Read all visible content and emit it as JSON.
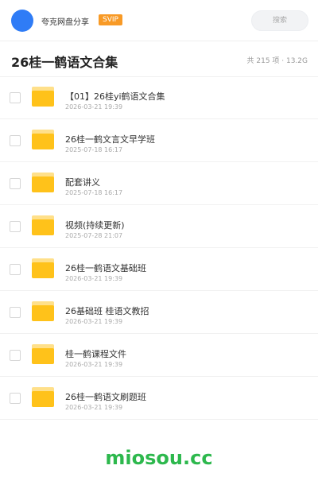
{
  "topbar": {
    "username": "夸克网盘分享",
    "vip_badge": "SVIP",
    "search_placeholder": "搜索"
  },
  "header": {
    "title": "26桂一鹤语文合集",
    "meta": "共 215 项 · 13.2G"
  },
  "files": [
    {
      "name": "【01】26桂yi鹤语文合集",
      "date": "2026-03-21 19:39"
    },
    {
      "name": "26桂一鹤文言文早学班",
      "date": "2025-07-18 16:17"
    },
    {
      "name": "配套讲义",
      "date": "2025-07-18 16:17"
    },
    {
      "name": "视频(持续更新)",
      "date": "2025-07-28 21:07"
    },
    {
      "name": "26桂一鹤语文基础班",
      "date": "2026-03-21 19:39"
    },
    {
      "name": "26基础班 桂语文教招",
      "date": "2026-03-21 19:39"
    },
    {
      "name": "桂一鹤课程文件",
      "date": "2026-03-21 19:39"
    },
    {
      "name": "26桂一鹤语文刷题班",
      "date": "2026-03-21 19:39"
    }
  ],
  "watermark": "miosou.cc"
}
